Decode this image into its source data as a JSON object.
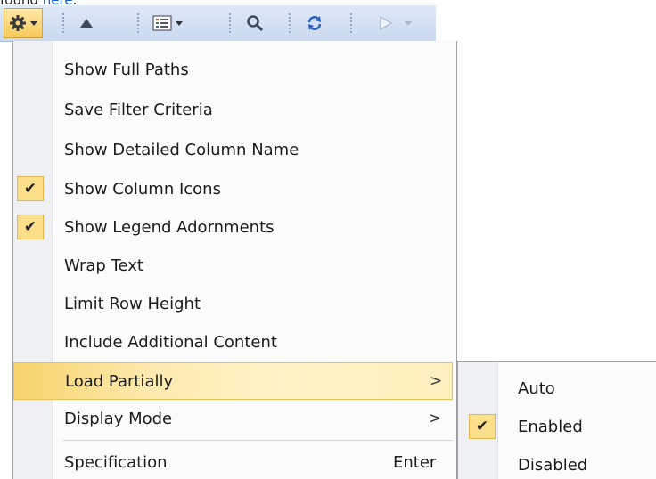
{
  "top_text": {
    "prefix": "found ",
    "link": "here",
    "suffix": "."
  },
  "toolbar": {
    "items": [
      {
        "icon": "gear-icon",
        "has_dropdown": true,
        "active": true
      },
      {
        "icon": "triangle-up-icon",
        "has_dropdown": false
      },
      {
        "icon": "list-view-icon",
        "has_dropdown": true
      },
      {
        "icon": "search-icon",
        "has_dropdown": false
      },
      {
        "icon": "refresh-icon",
        "has_dropdown": false
      },
      {
        "icon": "play-icon",
        "has_dropdown": true,
        "disabled": true
      }
    ],
    "background_color": "#d3e0f2",
    "active_color": "#f7c95a"
  },
  "menu": {
    "items": [
      {
        "label": "Show Full Paths",
        "checked": false
      },
      {
        "label": "Save Filter Criteria",
        "checked": false
      },
      {
        "label": "Show Detailed Column Name",
        "checked": false
      },
      {
        "label": "Show Column Icons",
        "checked": true
      },
      {
        "label": "Show Legend Adornments",
        "checked": true
      },
      {
        "label": "Wrap Text",
        "checked": false
      },
      {
        "label": "Limit Row Height",
        "checked": false
      },
      {
        "label": "Include Additional Content",
        "checked": false
      },
      {
        "label": "Load Partially",
        "checked": false,
        "submenu": true,
        "highlighted": true,
        "arrow": ">"
      },
      {
        "label": "Display Mode",
        "checked": false,
        "submenu": true,
        "arrow": ">"
      },
      {
        "label": "Specification",
        "checked": false,
        "shortcut": "Enter"
      }
    ],
    "check_glyph": "✔"
  },
  "submenu": {
    "items": [
      {
        "label": "Auto",
        "checked": false
      },
      {
        "label": "Enabled",
        "checked": true
      },
      {
        "label": "Disabled",
        "checked": false
      }
    ]
  }
}
